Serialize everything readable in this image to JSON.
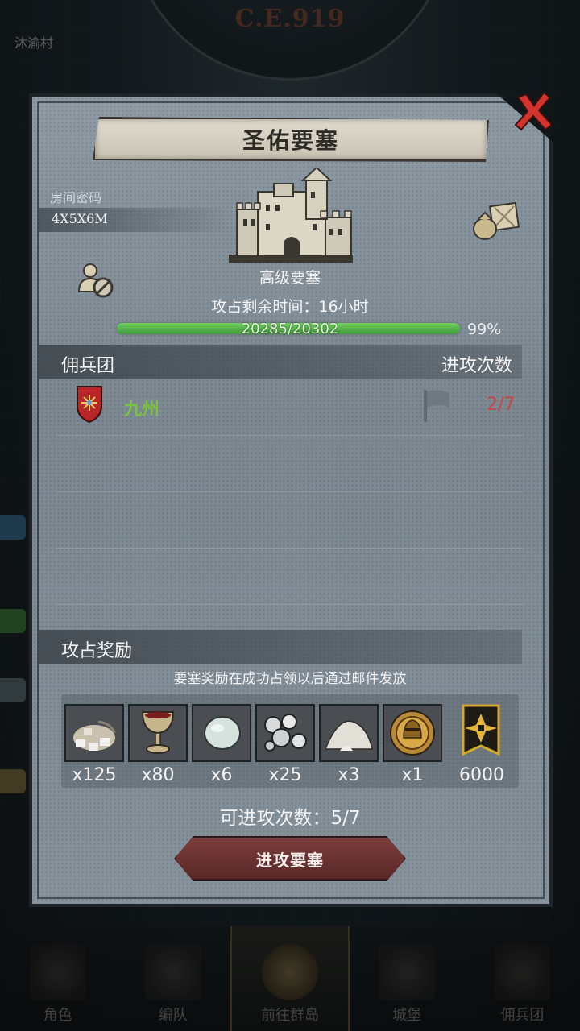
{
  "background": {
    "era": "C.E.919",
    "village": "沐渝村",
    "nav": [
      {
        "label": "角色",
        "icon": "character-icon"
      },
      {
        "label": "编队",
        "icon": "formation-icon"
      },
      {
        "label": "前往群岛",
        "icon": "islands-icon",
        "active": true
      },
      {
        "label": "城堡",
        "icon": "castle-icon"
      },
      {
        "label": "佣兵团",
        "icon": "mercenary-icon"
      }
    ]
  },
  "modal": {
    "title": "圣佑要塞",
    "room_code_label": "房间密码",
    "room_code": "4X5X6M",
    "fortress_level": "高级要塞",
    "time_remaining": "攻占剩余时间：16小时",
    "hp": {
      "current": 20285,
      "max": 20302,
      "text": "20285/20302",
      "percent": "99%",
      "fraction": 0.99
    },
    "mercenaries": {
      "header": "佣兵团",
      "header_right": "进攻次数",
      "rows": [
        {
          "name": "九州",
          "attacks": "2/7"
        }
      ]
    },
    "rewards": {
      "header": "攻占奖励",
      "note": "要塞奖励在成功占领以后通过邮件发放",
      "items": [
        {
          "icon": "ore-pile-icon",
          "count": "x125"
        },
        {
          "icon": "goblet-icon",
          "count": "x80"
        },
        {
          "icon": "gem-icon",
          "count": "x6"
        },
        {
          "icon": "silver-orbs-icon",
          "count": "x25"
        },
        {
          "icon": "powder-pile-icon",
          "count": "x3"
        },
        {
          "icon": "knight-medal-icon",
          "count": "x1"
        },
        {
          "icon": "rank-banner-icon",
          "count": "6000"
        }
      ]
    },
    "attack_count": "可进攻次数：5/7",
    "attack_button": "进攻要塞"
  },
  "colors": {
    "merc_name": "#7cc241",
    "attack_ratio": "#c54646",
    "hp_bar": "#4fb244",
    "button": "#6b3232",
    "close": "#d1342c"
  }
}
